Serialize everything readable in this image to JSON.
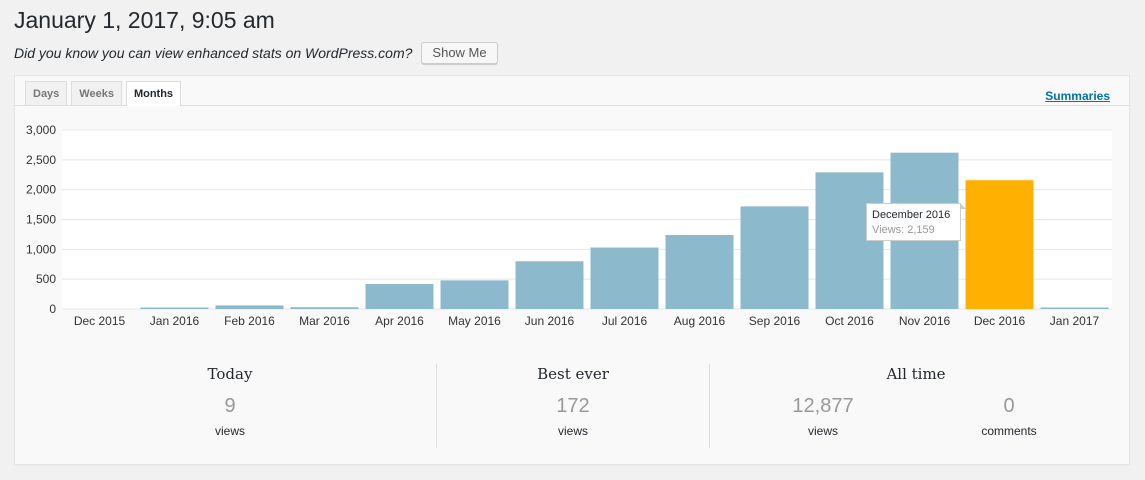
{
  "page": {
    "title": "January 1, 2017, 9:05 am"
  },
  "promo": {
    "text": "Did you know you can view enhanced stats on WordPress.com?",
    "button_label": "Show Me"
  },
  "tabs": [
    {
      "label": "Days",
      "active": false
    },
    {
      "label": "Weeks",
      "active": false
    },
    {
      "label": "Months",
      "active": true
    }
  ],
  "summaries_link": "Summaries",
  "chart_data": {
    "type": "bar",
    "categories": [
      "Dec 2015",
      "Jan 2016",
      "Feb 2016",
      "Mar 2016",
      "Apr 2016",
      "May 2016",
      "Jun 2016",
      "Jul 2016",
      "Aug 2016",
      "Sep 2016",
      "Oct 2016",
      "Nov 2016",
      "Dec 2016",
      "Jan 2017"
    ],
    "values": [
      0,
      25,
      60,
      30,
      420,
      480,
      800,
      1030,
      1240,
      1720,
      2290,
      2620,
      2159,
      9
    ],
    "yticks": [
      "0",
      "500",
      "1,000",
      "1,500",
      "2,000",
      "2,500",
      "3,000"
    ],
    "ylim": [
      0,
      3000
    ],
    "grid": true,
    "bar_color": "#8db9cc",
    "highlight_index": 12,
    "highlight_color": "#ffb000"
  },
  "tooltip": {
    "title": "December 2016",
    "value": "Views: 2,159"
  },
  "stats": {
    "today": {
      "heading": "Today",
      "value": "9",
      "label": "views"
    },
    "best": {
      "heading": "Best ever",
      "value": "172",
      "label": "views"
    },
    "alltime": {
      "heading": "All time",
      "views_value": "12,877",
      "views_label": "views",
      "comments_value": "0",
      "comments_label": "comments"
    }
  }
}
